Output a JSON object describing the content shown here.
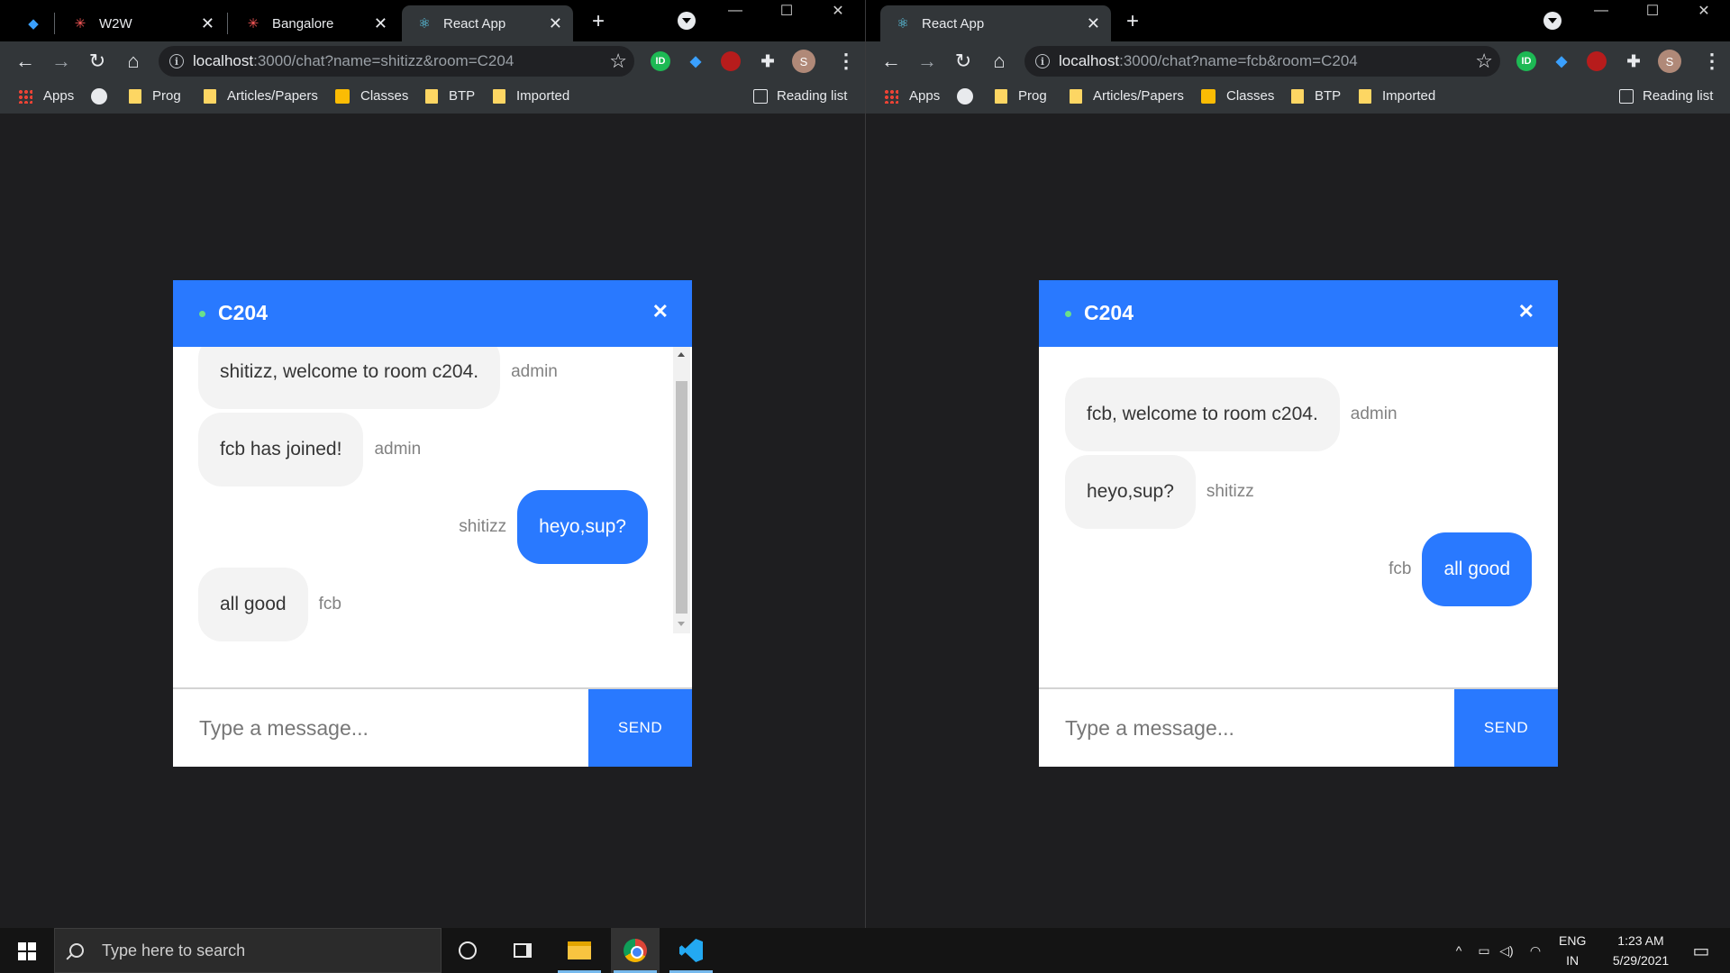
{
  "left_window": {
    "tabs": [
      {
        "title": "",
        "icon": "sapphire-gem-icon"
      },
      {
        "title": "W2W",
        "icon": "spark-icon"
      },
      {
        "title": "Bangalore",
        "icon": "spark-icon"
      },
      {
        "title": "React App",
        "icon": "react-icon"
      }
    ],
    "url_host": "localhost",
    "url_rest": ":3000/chat?name=shitizz&room=C204",
    "profile_initial": "S"
  },
  "right_window": {
    "tabs": [
      {
        "title": "React App",
        "icon": "react-icon"
      }
    ],
    "url_host": "localhost",
    "url_rest": ":3000/chat?name=fcb&room=C204",
    "profile_initial": "S"
  },
  "bookmarks": {
    "apps": "Apps",
    "items": [
      "Prog",
      "Articles/Papers",
      "Classes",
      "BTP",
      "Imported"
    ],
    "reading_list": "Reading list"
  },
  "tab_close_glyph": "✕",
  "new_tab_glyph": "+",
  "left_chat": {
    "room": "C204",
    "close_glyph": "✕",
    "messages": [
      {
        "text": "shitizz, welcome to room c204.",
        "sender": "admin",
        "mine": false
      },
      {
        "text": "fcb has joined!",
        "sender": "admin",
        "mine": false
      },
      {
        "text": "heyo,sup?",
        "sender": "shitizz",
        "mine": true
      },
      {
        "text": "all good",
        "sender": "fcb",
        "mine": false
      }
    ],
    "input_placeholder": "Type a message...",
    "send_label": "SEND"
  },
  "right_chat": {
    "room": "C204",
    "close_glyph": "✕",
    "messages": [
      {
        "text": "fcb, welcome to room c204.",
        "sender": "admin",
        "mine": false
      },
      {
        "text": "heyo,sup?",
        "sender": "shitizz",
        "mine": false
      },
      {
        "text": "all good",
        "sender": "fcb",
        "mine": true
      }
    ],
    "input_placeholder": "Type a message...",
    "send_label": "SEND"
  },
  "taskbar": {
    "search_placeholder": "Type here to search",
    "language_top": "ENG",
    "language_bottom": "IN",
    "time": "1:23 AM",
    "date": "5/29/2021"
  },
  "colors": {
    "chat_blue": "#2979ff",
    "online_green": "#6be08a",
    "bubble_gray": "#f3f3f3"
  }
}
